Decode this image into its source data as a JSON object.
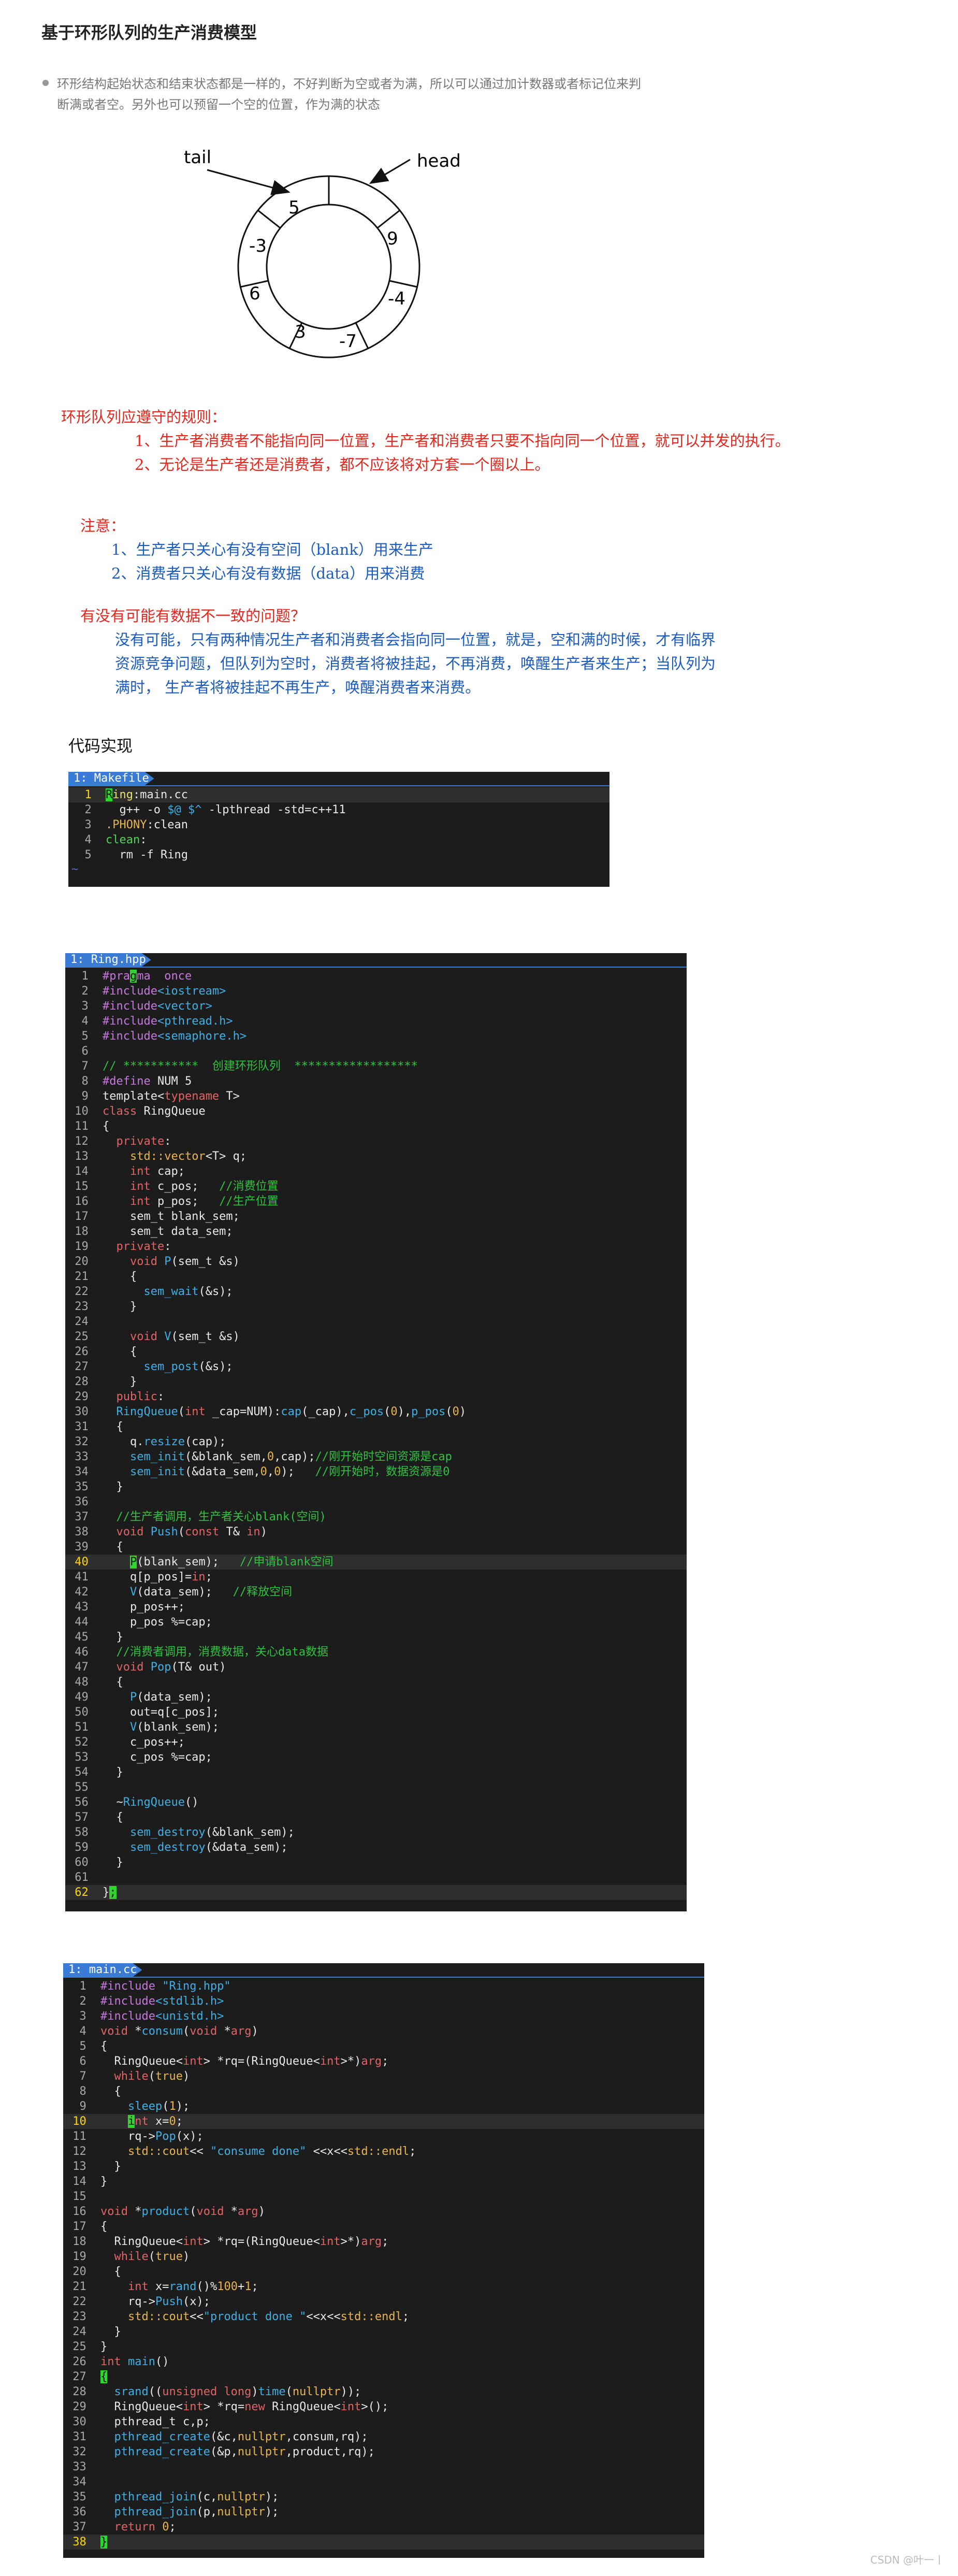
{
  "title": "基于环形队列的生产消费模型",
  "bullet": "环形结构起始状态和结束状态都是一样的，不好判断为空或者为满，所以可以通过加计数器或者标记位来判断满或者空。另外也可以预留一个空的位置，作为满的状态",
  "diagram": {
    "tail_label": "tail",
    "head_label": "head",
    "slots": [
      "5",
      "9",
      "-4",
      "-7",
      "3",
      "6",
      "-3"
    ]
  },
  "rules": {
    "heading": "环形队列应遵守的规则：",
    "items": [
      "1、生产者消费者不能指向同一位置，生产者和消费者只要不指向同一个位置，就可以并发的执行。",
      "2、无论是生产者还是消费者，都不应该将对方套一个圈以上。"
    ]
  },
  "note": {
    "heading": "注意：",
    "items": [
      "1、生产者只关心有没有空间（blank）用来生产",
      "2、消费者只关心有没有数据（data）用来消费"
    ]
  },
  "question": {
    "heading": "有没有可能有数据不一致的问题？",
    "lines": [
      "没有可能，只有两种情况生产者和消费者会指向同一位置，就是，空和满的时候，才有临界",
      "资源竞争问题，但队列为空时，消费者将被挂起，不再消费，唤醒生产者来生产；当队列为",
      "满时， 生产者将被挂起不再生产，唤醒消费者来消费。"
    ]
  },
  "code_label": "代码实现",
  "makefile": {
    "tab": "1: Makefile"
  },
  "ring": {
    "tab": "1: Ring.hpp"
  },
  "main": {
    "tab": "1: main.cc"
  },
  "watermark": "CSDN @叶一丨"
}
